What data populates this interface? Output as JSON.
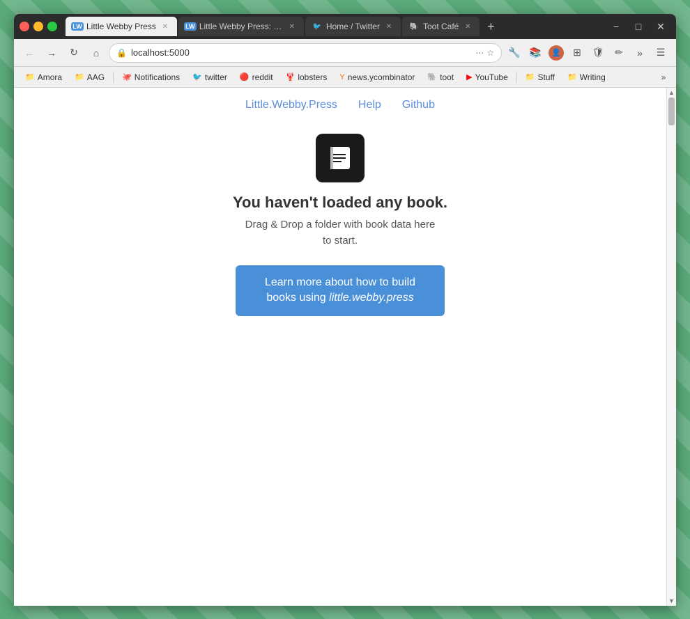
{
  "browser": {
    "tabs": [
      {
        "id": "tab-lwp-1",
        "label": "Little Webby Press",
        "favicon": "📄",
        "favicon_type": "lwp",
        "active": true,
        "url": "localhost:5000"
      },
      {
        "id": "tab-lwp-2",
        "label": "Little Webby Press: first",
        "favicon": "📄",
        "favicon_type": "lwp",
        "active": false,
        "url": ""
      },
      {
        "id": "tab-twitter",
        "label": "Home / Twitter",
        "favicon": "🐦",
        "favicon_type": "twitter",
        "active": false,
        "url": ""
      },
      {
        "id": "tab-toot",
        "label": "Toot Café",
        "favicon": "🐘",
        "favicon_type": "toot",
        "active": false,
        "url": ""
      }
    ],
    "address": "localhost:5000",
    "new_tab_title": "New Tab"
  },
  "window_controls": {
    "minimize": "−",
    "maximize": "□",
    "close": "✕"
  },
  "bookmarks": [
    {
      "id": "bm-amora",
      "label": "Amora",
      "icon": "📁"
    },
    {
      "id": "bm-aag",
      "label": "AAG",
      "icon": "📁"
    },
    {
      "id": "bm-notifications",
      "label": "Notifications",
      "icon": "🐙",
      "color": "#333"
    },
    {
      "id": "bm-twitter",
      "label": "twitter",
      "icon": "🐦",
      "color": "#1da1f2"
    },
    {
      "id": "bm-reddit",
      "label": "reddit",
      "icon": "🔴"
    },
    {
      "id": "bm-lobsters",
      "label": "lobsters",
      "icon": "🦞"
    },
    {
      "id": "bm-ycombinator",
      "label": "news.ycombinator",
      "icon": "🟧"
    },
    {
      "id": "bm-toot",
      "label": "toot",
      "icon": "🐘"
    },
    {
      "id": "bm-youtube",
      "label": "YouTube",
      "icon": "▶"
    },
    {
      "id": "bm-stuff",
      "label": "Stuff",
      "icon": "📁"
    },
    {
      "id": "bm-writing",
      "label": "Writing",
      "icon": "📁"
    }
  ],
  "site": {
    "nav_links": [
      {
        "id": "nav-lwp",
        "label": "Little.Webby.Press"
      },
      {
        "id": "nav-help",
        "label": "Help"
      },
      {
        "id": "nav-github",
        "label": "Github"
      }
    ],
    "hero": {
      "heading": "You haven't loaded any book.",
      "subtext_line1": "Drag & Drop a folder with book data here",
      "subtext_line2": "to start.",
      "cta_label": "Learn more about how to build books using ",
      "cta_italic": "little.webby.press"
    }
  }
}
